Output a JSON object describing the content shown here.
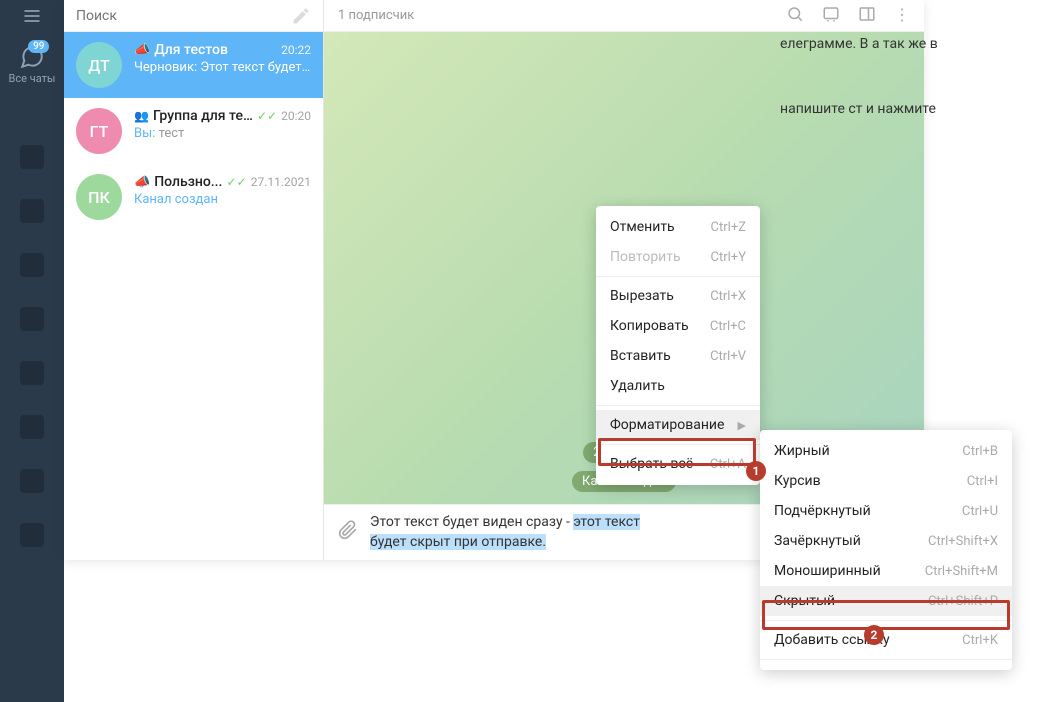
{
  "leftbar": {
    "allchats": "Все чаты",
    "badge": "99"
  },
  "search": {
    "placeholder": "Поиск"
  },
  "chats": [
    {
      "avatar": "ДТ",
      "title": "Для тестов",
      "time": "20:22",
      "draft_label": "Черновик:",
      "draft_text": " Этот текст будет ..."
    },
    {
      "avatar": "ГТ",
      "title": "Группа для те...",
      "time": "20:20",
      "you": "Вы:",
      "sub": " тест"
    },
    {
      "avatar": "ПК",
      "title": "Пользно...",
      "time": "27.11.2021",
      "sub": "Канал создан"
    }
  ],
  "header": {
    "subscribers": "1 подписчик"
  },
  "bg": {
    "date": "27 ноября",
    "service": "Канал создан"
  },
  "input": {
    "part1": "Этот текст будет виден сразу - ",
    "sel1": "этот текст",
    "part2": " ",
    "sel2": "будет скрыт при отправке."
  },
  "ctx1": [
    {
      "label": "Отменить",
      "sc": "Ctrl+Z"
    },
    {
      "label": "Повторить",
      "sc": "Ctrl+Y",
      "disabled": true
    },
    {
      "sep": true
    },
    {
      "label": "Вырезать",
      "sc": "Ctrl+X"
    },
    {
      "label": "Копировать",
      "sc": "Ctrl+C"
    },
    {
      "label": "Вставить",
      "sc": "Ctrl+V"
    },
    {
      "label": "Удалить"
    },
    {
      "sep": true
    },
    {
      "label": "Форматирование",
      "submenu": true,
      "hl": true
    },
    {
      "sep": true
    },
    {
      "label": "Выбрать всё",
      "sc": "Ctrl+A"
    }
  ],
  "ctx2": [
    {
      "label": "Жирный",
      "sc": "Ctrl+B"
    },
    {
      "label": "Курсив",
      "sc": "Ctrl+I"
    },
    {
      "label": "Подчёркнутый",
      "sc": "Ctrl+U"
    },
    {
      "label": "Зачёркнутый",
      "sc": "Ctrl+Shift+X"
    },
    {
      "label": "Моноширинный",
      "sc": "Ctrl+Shift+M"
    },
    {
      "label": "Скрытый",
      "sc": "Ctrl+Shift+P",
      "hl": true
    },
    {
      "sep": true
    },
    {
      "label": "Добавить ссылку",
      "sc": "Ctrl+K"
    },
    {
      "sep": true
    }
  ],
  "right": {
    "p1": "елеграмме. В а так же в",
    "p2": "напишите ст и нажмите"
  },
  "badges": {
    "b1": "1",
    "b2": "2"
  }
}
